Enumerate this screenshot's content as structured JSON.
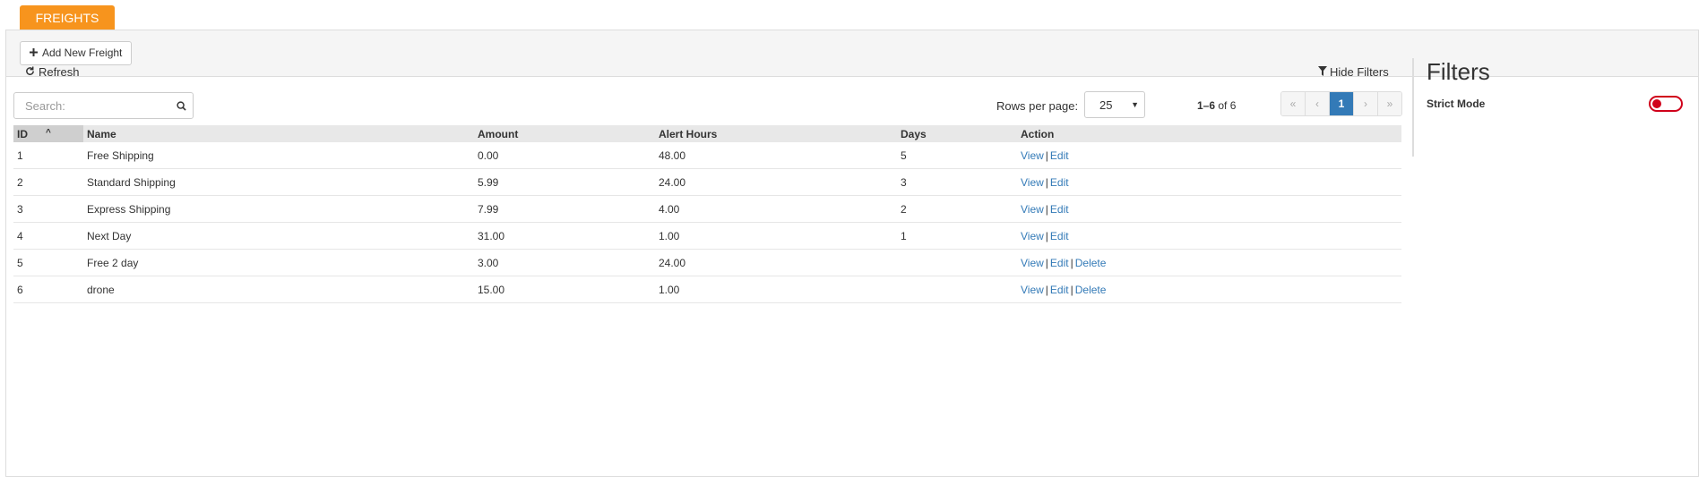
{
  "tab": {
    "label": "FREIGHTS"
  },
  "toolbar": {
    "add_label": "Add New Freight"
  },
  "controls": {
    "refresh_label": "Refresh",
    "hide_filters_label": "Hide Filters",
    "search_placeholder": "Search:",
    "rows_per_page_label": "Rows per page:",
    "rows_per_page_value": "25",
    "range_start_end": "1–6",
    "range_of": "of 6"
  },
  "pagination": {
    "first": "«",
    "prev": "‹",
    "current": "1",
    "next": "›",
    "last": "»"
  },
  "table": {
    "headers": [
      "ID",
      "Name",
      "Amount",
      "Alert Hours",
      "Days",
      "Action"
    ],
    "rows": [
      {
        "id": "1",
        "name": "Free Shipping",
        "amount": "0.00",
        "alert_hours": "48.00",
        "days": "5",
        "actions": [
          "View",
          "Edit"
        ]
      },
      {
        "id": "2",
        "name": "Standard Shipping",
        "amount": "5.99",
        "alert_hours": "24.00",
        "days": "3",
        "actions": [
          "View",
          "Edit"
        ]
      },
      {
        "id": "3",
        "name": "Express Shipping",
        "amount": "7.99",
        "alert_hours": "4.00",
        "days": "2",
        "actions": [
          "View",
          "Edit"
        ]
      },
      {
        "id": "4",
        "name": "Next Day",
        "amount": "31.00",
        "alert_hours": "1.00",
        "days": "1",
        "actions": [
          "View",
          "Edit"
        ]
      },
      {
        "id": "5",
        "name": "Free 2 day",
        "amount": "3.00",
        "alert_hours": "24.00",
        "days": "",
        "actions": [
          "View",
          "Edit",
          "Delete"
        ]
      },
      {
        "id": "6",
        "name": "drone",
        "amount": "15.00",
        "alert_hours": "1.00",
        "days": "",
        "actions": [
          "View",
          "Edit",
          "Delete"
        ]
      }
    ]
  },
  "filters": {
    "title": "Filters",
    "strict_mode_label": "Strict Mode",
    "strict_mode_on": false
  },
  "colors": {
    "tab": "#f7941d",
    "link": "#337ab7",
    "active_page": "#337ab7",
    "toggle": "#d0021b"
  },
  "icons": [
    "plus-icon",
    "refresh-icon",
    "filter-icon",
    "search-icon",
    "sort-caret-up-icon",
    "chevron-down-icon"
  ]
}
